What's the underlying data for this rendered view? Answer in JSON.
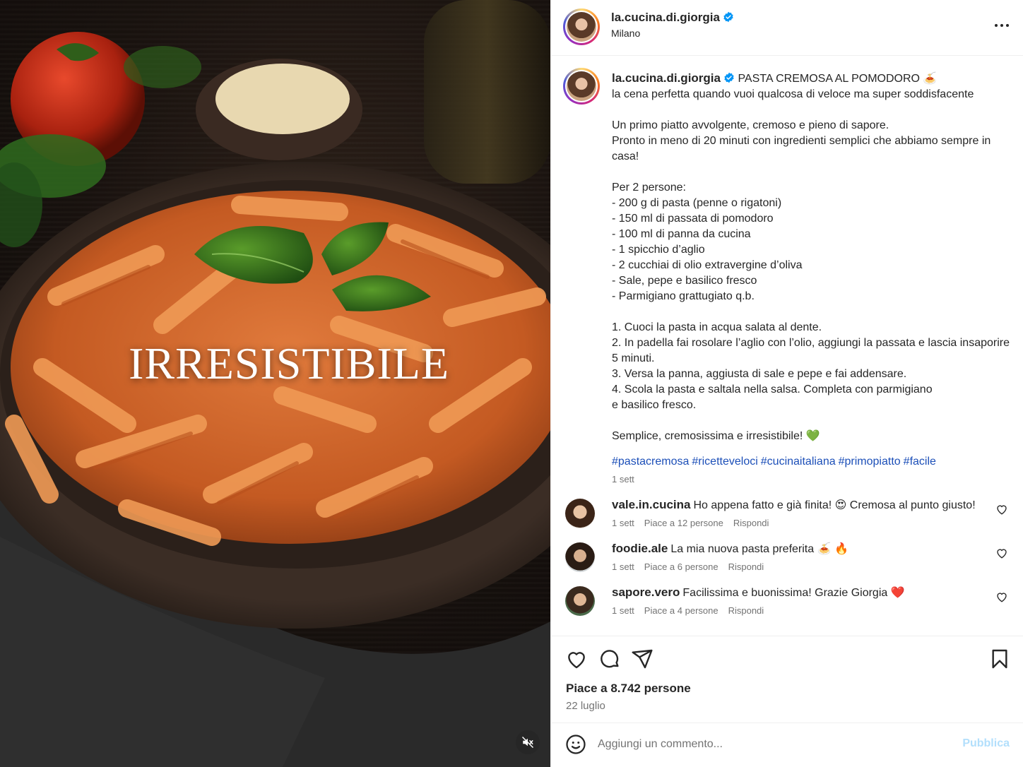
{
  "post": {
    "username": "la.cucina.di.giorgia",
    "location": "Milano",
    "overlay_text": "IRRESISTIBILE",
    "caption_title": "PASTA CREMOSA AL POMODORO 🍝",
    "caption_body": "la cena perfetta quando vuoi qualcosa di veloce ma super soddisfacente\n\nUn primo piatto avvolgente, cremoso e pieno di sapore.\nPronto in meno di 20 minuti con ingredienti semplici che abbiamo sempre in casa!\n\nPer 2 persone:\n- 200 g di pasta (penne o rigatoni)\n- 150 ml di passata di pomodoro\n- 100 ml di panna da cucina\n- 1 spicchio d’aglio\n- 2 cucchiai di olio extravergine d’oliva\n- Sale, pepe e basilico fresco\n- Parmigiano grattugiato q.b.\n\n1. Cuoci la pasta in acqua salata al dente.\n2. In padella fai rosolare l’aglio con l’olio, aggiungi la passata e lascia insaporire 5 minuti.\n3. Versa la panna, aggiusta di sale e pepe e fai addensare.\n4. Scola la pasta e saltala nella salsa. Completa con parmigiano\ne basilico fresco.\n\nSemplice, cremosissima e irresistibile! 💚",
    "hashtags": [
      "#pastacremosa",
      "#ricetteveloci",
      "#cucinaitaliana",
      "#primopiatto",
      "#facile"
    ],
    "caption_time": "1 sett",
    "likes_text": "Piace a 8.742 persone",
    "date": "22 luglio"
  },
  "comments": [
    {
      "user": "vale.in.cucina",
      "text": "Ho appena fatto e già finita! 😍 Cremosa al punto giusto!",
      "time": "1 sett",
      "likes": "Piace a 12 persone",
      "reply": "Rispondi"
    },
    {
      "user": "foodie.ale",
      "text": "La mia nuova pasta preferita 🍝 🔥",
      "time": "1 sett",
      "likes": "Piace a 6 persone",
      "reply": "Rispondi"
    },
    {
      "user": "sapore.vero",
      "text": "Facilissima e buonissima! Grazie Giorgia ❤️",
      "time": "1 sett",
      "likes": "Piace a 4 persone",
      "reply": "Rispondi"
    }
  ],
  "add_comment": {
    "placeholder": "Aggiungi un commento...",
    "publish_label": "Pubblica"
  },
  "colors": {
    "verified": "#0095f6",
    "hashtag": "#1c4fb8",
    "publish_disabled": "#b2dffc"
  },
  "icons": [
    "verified-badge-icon",
    "more-options-icon",
    "heart-icon",
    "comment-icon",
    "share-icon",
    "bookmark-icon",
    "emoji-icon",
    "mute-icon"
  ]
}
